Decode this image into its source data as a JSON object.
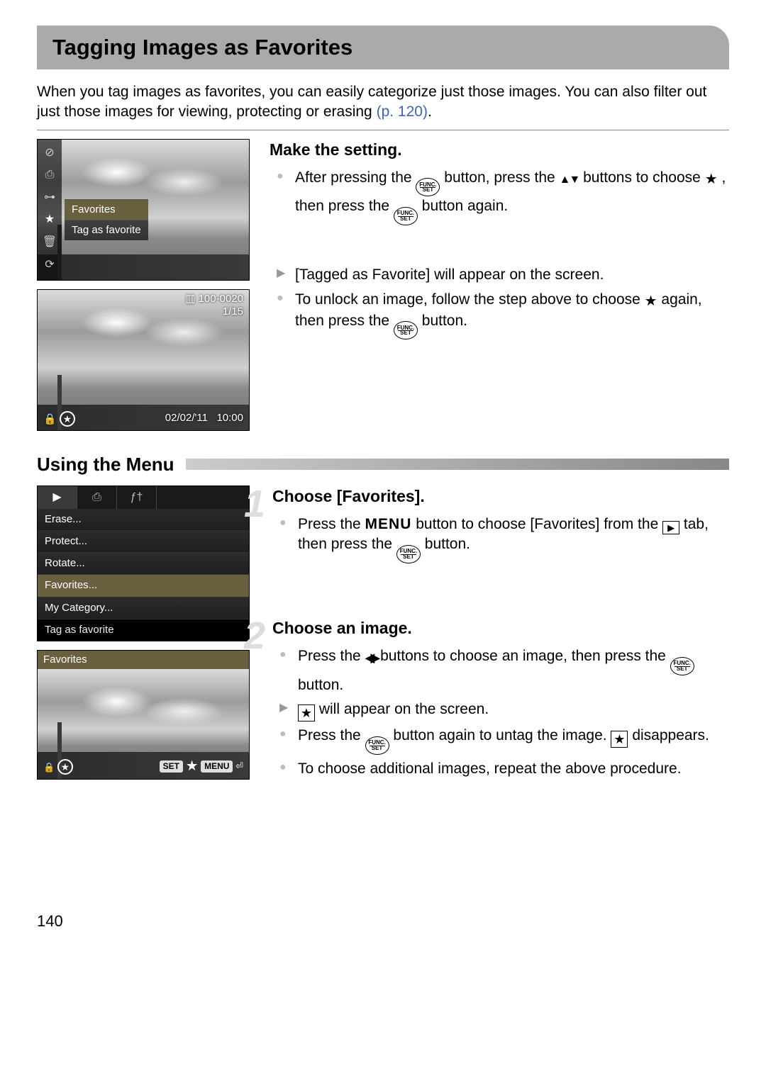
{
  "page": {
    "title": "Tagging Images as Favorites",
    "intro_a": "When you tag images as favorites, you can easily categorize just those images. You can also filter out just those images for viewing, protecting or erasing ",
    "intro_pageref": "(p. 120)",
    "intro_b": ".",
    "page_number": "140"
  },
  "section1": {
    "heading": "Make the setting.",
    "b1a": "After pressing the ",
    "b1b": " button, press the ",
    "b1c": " buttons to choose ",
    "b1d": ", then press the ",
    "b1e": " button again.",
    "b2": "[Tagged as Favorite] will appear on the screen.",
    "b3a": "To unlock an image, follow the step above to choose ",
    "b3b": " again, then press the ",
    "b3c": " button."
  },
  "shot1": {
    "menu_favorites": "Favorites",
    "menu_tag": "Tag as favorite"
  },
  "shot2": {
    "img_num": "100-0020",
    "counter": "1/15",
    "date": "02/02/'11",
    "time": "10:00"
  },
  "subhead": "Using the Menu",
  "menu": {
    "items": [
      "Erase...",
      "Protect...",
      "Rotate...",
      "Favorites...",
      "My Category..."
    ],
    "caption": "Tag as favorite",
    "fav_header": "Favorites",
    "bot_set": "SET",
    "bot_menu": "MENU"
  },
  "step1": {
    "num": "1",
    "heading": "Choose [Favorites].",
    "b1a": "Press the ",
    "b1b": " button to choose [Favorites] from the ",
    "b1c": " tab, then press the ",
    "b1d": " button.",
    "menu_label": "MENU"
  },
  "step2": {
    "num": "2",
    "heading": "Choose an image.",
    "b1a": "Press the ",
    "b1b": " buttons to choose an image, then press the ",
    "b1c": " button.",
    "b2a": " will appear on the screen.",
    "b3a": "Press the ",
    "b3b": " button again to untag the image. ",
    "b3c": " disappears.",
    "b4": "To choose additional images, repeat the above procedure."
  }
}
